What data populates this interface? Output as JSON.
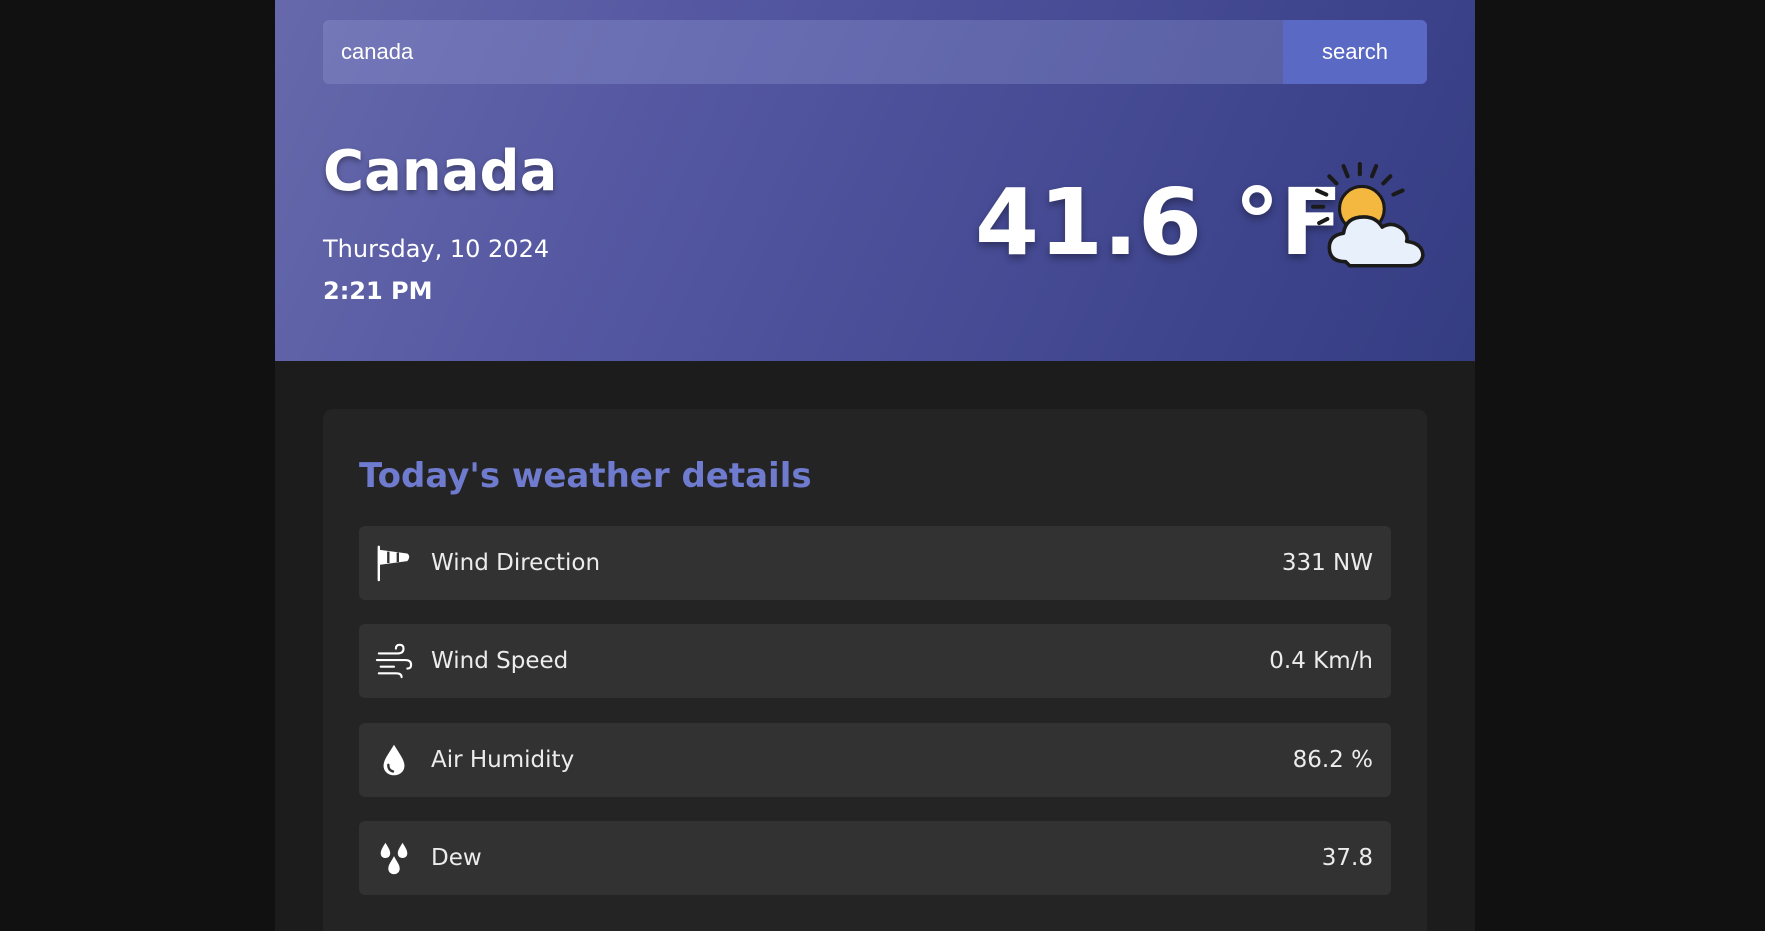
{
  "search": {
    "value": "canada",
    "button_label": "search"
  },
  "current": {
    "city": "Canada",
    "date": "Thursday, 10 2024",
    "time": "2:21 PM",
    "temperature": "41.6 °F",
    "condition_icon": "partly-cloudy-icon"
  },
  "details": {
    "title": "Today's weather details",
    "items": [
      {
        "icon": "windsock-icon",
        "label": "Wind Direction",
        "value": "331 NW"
      },
      {
        "icon": "wind-icon",
        "label": "Wind Speed",
        "value": "0.4 Km/h"
      },
      {
        "icon": "droplet-icon",
        "label": "Air Humidity",
        "value": "86.2 %"
      },
      {
        "icon": "drops-icon",
        "label": "Dew",
        "value": "37.8"
      }
    ]
  },
  "colors": {
    "page_background": "#111111",
    "panel_background": "#1c1c1c",
    "hero_gradient_start": "#6669ab",
    "hero_gradient_end": "#343c82",
    "search_button": "#5a69c4",
    "accent_title": "#6f7bce",
    "card_background": "#242424",
    "row_background": "#323232",
    "sun": "#f4b73f"
  }
}
